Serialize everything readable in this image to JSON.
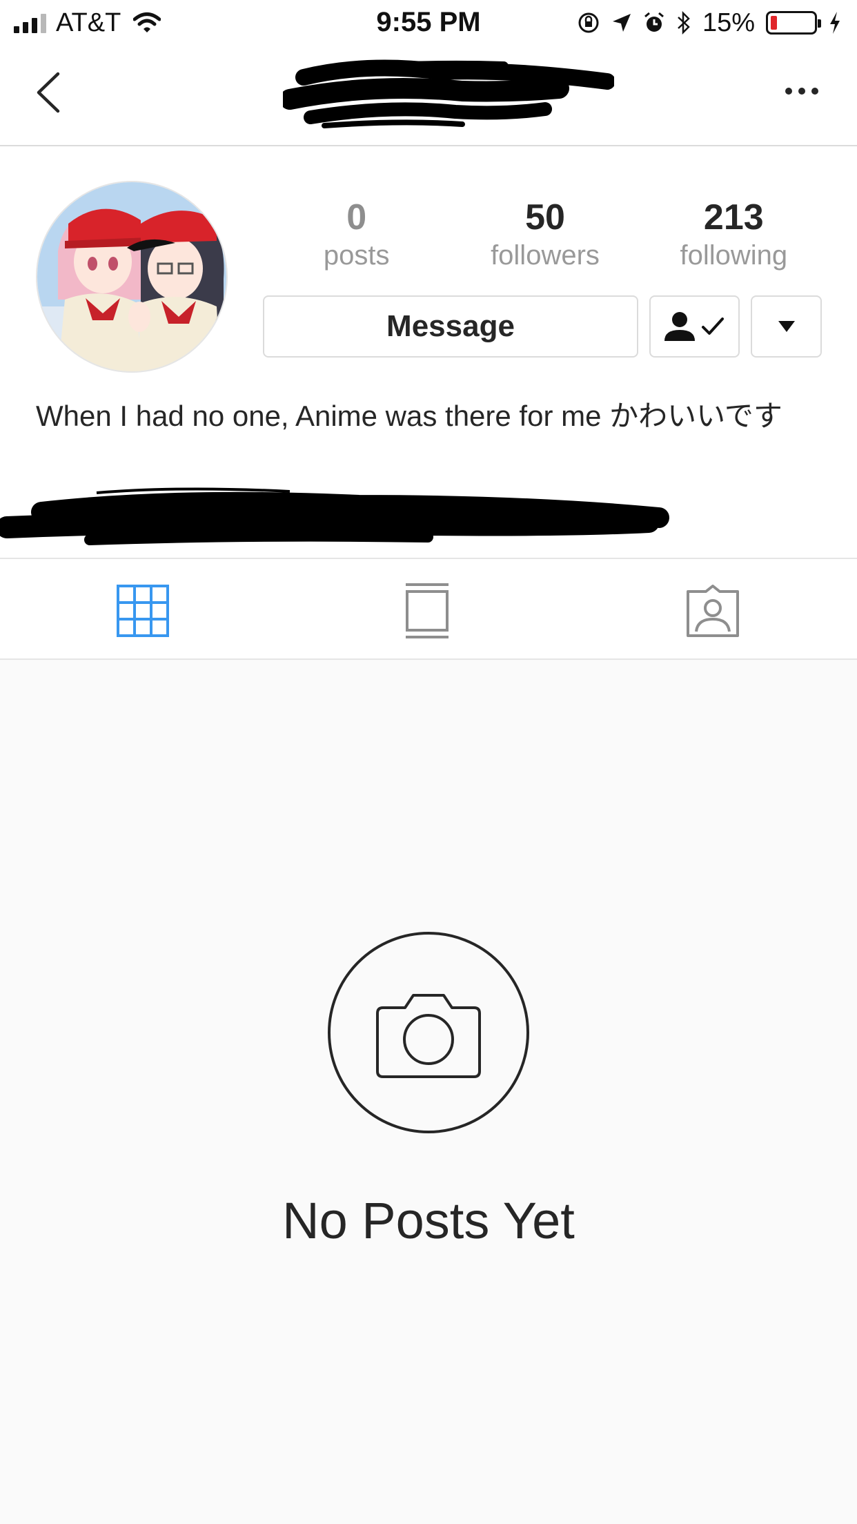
{
  "status_bar": {
    "carrier": "AT&T",
    "time": "9:55 PM",
    "battery_percent": "15%",
    "battery_level": 0.15,
    "battery_color": "#e0262a",
    "icons": [
      "signal-icon",
      "wifi-icon",
      "orientation-lock-icon",
      "location-icon",
      "alarm-icon",
      "bluetooth-icon",
      "battery-icon",
      "charging-icon"
    ]
  },
  "nav": {
    "back_icon": "chevron-left-icon",
    "username": "[redacted]",
    "more_icon": "more-horizontal-icon"
  },
  "profile": {
    "stats": [
      {
        "value": "0",
        "label": "posts"
      },
      {
        "value": "50",
        "label": "followers"
      },
      {
        "value": "213",
        "label": "following"
      }
    ],
    "message_label": "Message",
    "follow_state_icon": "following-check-icon",
    "dropdown_icon": "caret-down-icon",
    "bio": "When I had no one, Anime was there for me かわいいです"
  },
  "tabs": [
    {
      "icon": "grid-icon",
      "active": true
    },
    {
      "icon": "feed-list-icon",
      "active": false
    },
    {
      "icon": "tagged-photos-icon",
      "active": false
    }
  ],
  "colors": {
    "active_tab": "#3897f0",
    "inactive_tab": "#8e8e8e"
  },
  "empty_state": {
    "icon": "camera-icon",
    "title": "No Posts Yet"
  }
}
